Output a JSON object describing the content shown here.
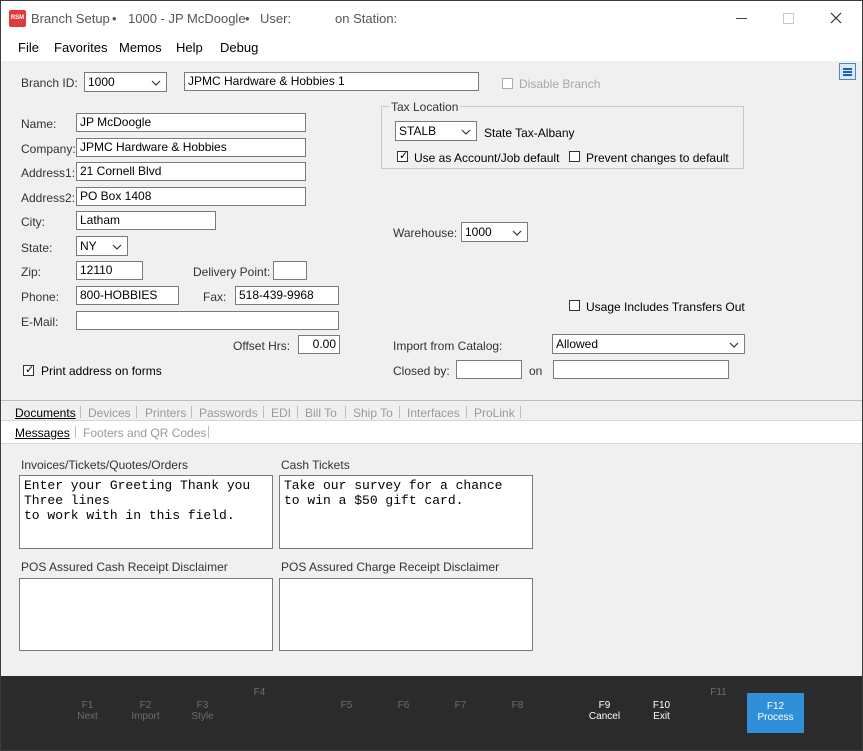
{
  "titlebar": {
    "app_logo": "RSM",
    "title": "Branch Setup",
    "sep1": "•",
    "branch_title": "1000 - JP McDoogle",
    "sep2": "•",
    "user_label": "User:",
    "station_label": "on Station:"
  },
  "menu": [
    "File",
    "Favorites",
    "Memos",
    "Help",
    "Debug"
  ],
  "branch": {
    "id_label": "Branch ID:",
    "id_value": "1000",
    "name_value": "JPMC Hardware & Hobbies 1",
    "disable_label": "Disable Branch",
    "disable_checked": false
  },
  "address": {
    "name_label": "Name:",
    "name_value": "JP McDoogle",
    "company_label": "Company:",
    "company_value": "JPMC Hardware & Hobbies",
    "address1_label": "Address1:",
    "address1_value": "21 Cornell Blvd",
    "address2_label": "Address2:",
    "address2_value": "PO Box 1408",
    "city_label": "City:",
    "city_value": "Latham",
    "state_label": "State:",
    "state_value": "NY",
    "zip_label": "Zip:",
    "zip_value": "12110",
    "delivery_point_label": "Delivery Point:",
    "delivery_point_value": "",
    "phone_label": "Phone:",
    "phone_value": "800-HOBBIES",
    "fax_label": "Fax:",
    "fax_value": "518-439-9968",
    "email_label": "E-Mail:",
    "email_value": "",
    "offset_label": "Offset Hrs:",
    "offset_value": "0.00",
    "print_address_label": "Print address on forms",
    "print_address_checked": true
  },
  "tax": {
    "group_label": "Tax Location",
    "code_value": "STALB",
    "description": "State Tax-Albany",
    "use_default_label": "Use as Account/Job default",
    "use_default_checked": true,
    "prevent_changes_label": "Prevent changes to default",
    "prevent_changes_checked": false
  },
  "warehouse": {
    "label": "Warehouse:",
    "value": "1000",
    "usage_transfers_label": "Usage Includes Transfers Out",
    "usage_transfers_checked": false,
    "import_catalog_label": "Import from Catalog:",
    "import_catalog_value": "Allowed",
    "closed_by_label": "Closed by:",
    "closed_by_value": "",
    "on_label": "on",
    "on_value": ""
  },
  "tabs_row1": [
    "Documents",
    "Devices",
    "Printers",
    "Passwords",
    "EDI",
    "Bill To",
    "Ship To",
    "Interfaces",
    "ProLink"
  ],
  "tabs_row2": [
    "Messages",
    "Footers and QR Codes"
  ],
  "messages": {
    "invoices_label": "Invoices/Tickets/Quotes/Orders",
    "invoices_text": "Enter your Greeting Thank you\nThree lines\nto work with in this field.",
    "cash_tickets_label": "Cash Tickets",
    "cash_tickets_text": "Take our survey for a chance\nto win a $50 gift card.",
    "cash_receipt_label": "POS Assured Cash Receipt Disclaimer",
    "cash_receipt_text": "",
    "charge_receipt_label": "POS Assured Charge Receipt Disclaimer",
    "charge_receipt_text": ""
  },
  "fkeys": [
    {
      "key": "F1",
      "label": "Next"
    },
    {
      "key": "F2",
      "label": "Import"
    },
    {
      "key": "F3",
      "label": "Style"
    },
    {
      "key": "F4",
      "label": ""
    },
    {
      "key": "F5",
      "label": ""
    },
    {
      "key": "F6",
      "label": ""
    },
    {
      "key": "F7",
      "label": ""
    },
    {
      "key": "F8",
      "label": ""
    },
    {
      "key": "F9",
      "label": "Cancel"
    },
    {
      "key": "F10",
      "label": "Exit"
    },
    {
      "key": "F11",
      "label": ""
    },
    {
      "key": "F12",
      "label": "Process"
    }
  ],
  "colors": {
    "accent": "#2f8fd8",
    "logo": "#e03a3e",
    "footer_bg": "#2b2b2b"
  }
}
